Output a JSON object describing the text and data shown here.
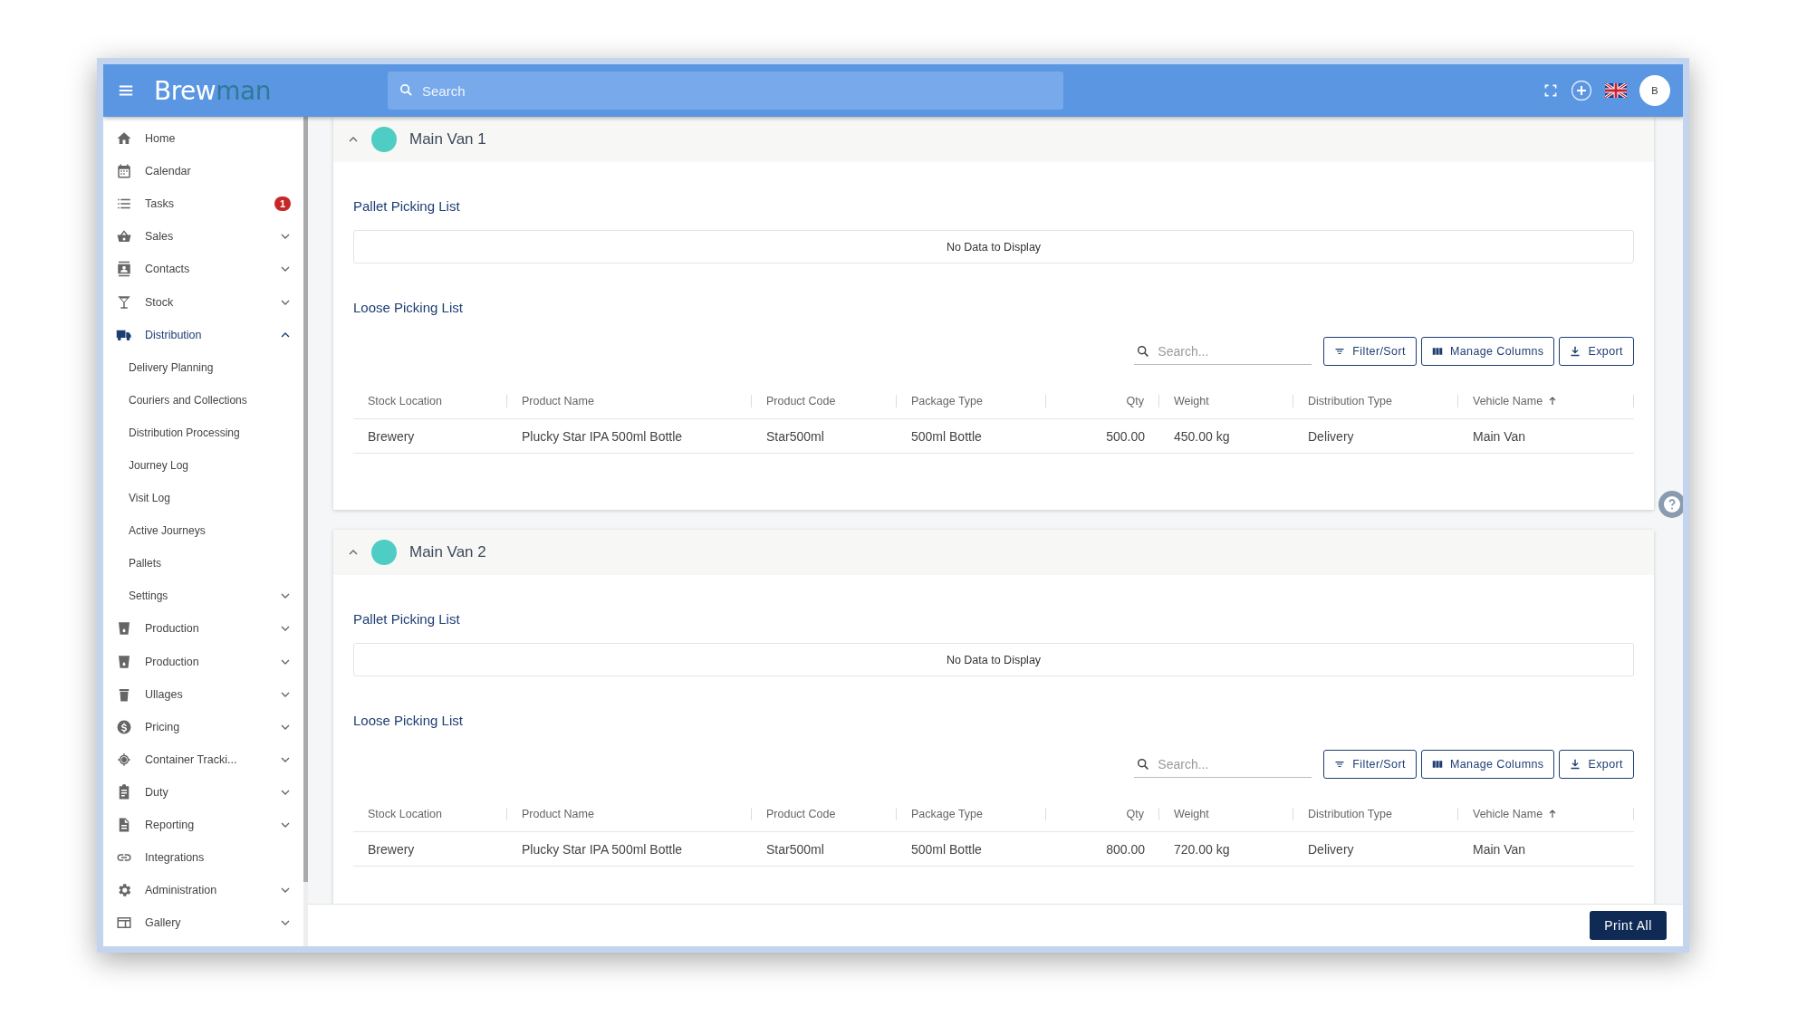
{
  "topbar": {
    "logo": {
      "text": "Brew",
      "accent": "man"
    },
    "search": {
      "placeholder": "Search"
    },
    "avatar": "B"
  },
  "sidebar": {
    "items": [
      {
        "label": "Home"
      },
      {
        "label": "Calendar"
      },
      {
        "label": "Tasks",
        "badge": "1"
      },
      {
        "label": "Sales",
        "expanded": false
      },
      {
        "label": "Contacts",
        "expanded": false
      },
      {
        "label": "Stock",
        "expanded": false
      },
      {
        "label": "Distribution",
        "expanded": true,
        "selected": true,
        "children": [
          {
            "label": "Delivery Planning"
          },
          {
            "label": "Couriers and Collections"
          },
          {
            "label": "Distribution Processing"
          },
          {
            "label": "Journey Log"
          },
          {
            "label": "Visit Log"
          },
          {
            "label": "Active Journeys"
          },
          {
            "label": "Pallets"
          },
          {
            "label": "Settings",
            "expanded": false
          }
        ]
      },
      {
        "label": "Production",
        "expanded": false
      },
      {
        "label": "Production",
        "expanded": false
      },
      {
        "label": "Ullages",
        "expanded": false
      },
      {
        "label": "Pricing",
        "expanded": false
      },
      {
        "label": "Container Tracki...",
        "expanded": false
      },
      {
        "label": "Duty",
        "expanded": false
      },
      {
        "label": "Reporting",
        "expanded": false
      },
      {
        "label": "Integrations"
      },
      {
        "label": "Administration",
        "expanded": false
      },
      {
        "label": "Gallery",
        "expanded": false
      }
    ]
  },
  "vans": [
    {
      "name": "Main Van 1",
      "expanded": true,
      "pallet_title": "Pallet Picking List",
      "pallet_empty": "No Data to Display",
      "loose_title": "Loose Picking List",
      "search_placeholder": "Search...",
      "buttons": [
        "Filter/Sort",
        "Manage Columns",
        "Export"
      ],
      "columns": [
        {
          "label": "Stock Location",
          "sorted": false
        },
        {
          "label": "Product Name",
          "sorted": false
        },
        {
          "label": "Product Code",
          "sorted": false
        },
        {
          "label": "Package Type",
          "sorted": false
        },
        {
          "label": "Qty",
          "sorted": false
        },
        {
          "label": "Weight",
          "sorted": false
        },
        {
          "label": "Distribution Type",
          "sorted": false
        },
        {
          "label": "Vehicle Name",
          "sorted": true
        }
      ],
      "rows": [
        [
          "Brewery",
          "Plucky Star IPA 500ml Bottle",
          "Star500ml",
          "500ml Bottle",
          "500.00",
          "450.00 kg",
          "Delivery",
          "Main Van"
        ]
      ]
    },
    {
      "name": "Main Van 2",
      "expanded": true,
      "pallet_title": "Pallet Picking List",
      "pallet_empty": "No Data to Display",
      "loose_title": "Loose Picking List",
      "search_placeholder": "Search...",
      "buttons": [
        "Filter/Sort",
        "Manage Columns",
        "Export"
      ],
      "columns": [
        {
          "label": "Stock Location",
          "sorted": false
        },
        {
          "label": "Product Name",
          "sorted": false
        },
        {
          "label": "Product Code",
          "sorted": false
        },
        {
          "label": "Package Type",
          "sorted": false
        },
        {
          "label": "Qty",
          "sorted": false
        },
        {
          "label": "Weight",
          "sorted": false
        },
        {
          "label": "Distribution Type",
          "sorted": false
        },
        {
          "label": "Vehicle Name",
          "sorted": true
        }
      ],
      "rows": [
        [
          "Brewery",
          "Plucky Star IPA 500ml Bottle",
          "Star500ml",
          "500ml Bottle",
          "800.00",
          "720.00 kg",
          "Delivery",
          "Main Van"
        ]
      ]
    }
  ],
  "footer": {
    "print_button": "Print All"
  }
}
